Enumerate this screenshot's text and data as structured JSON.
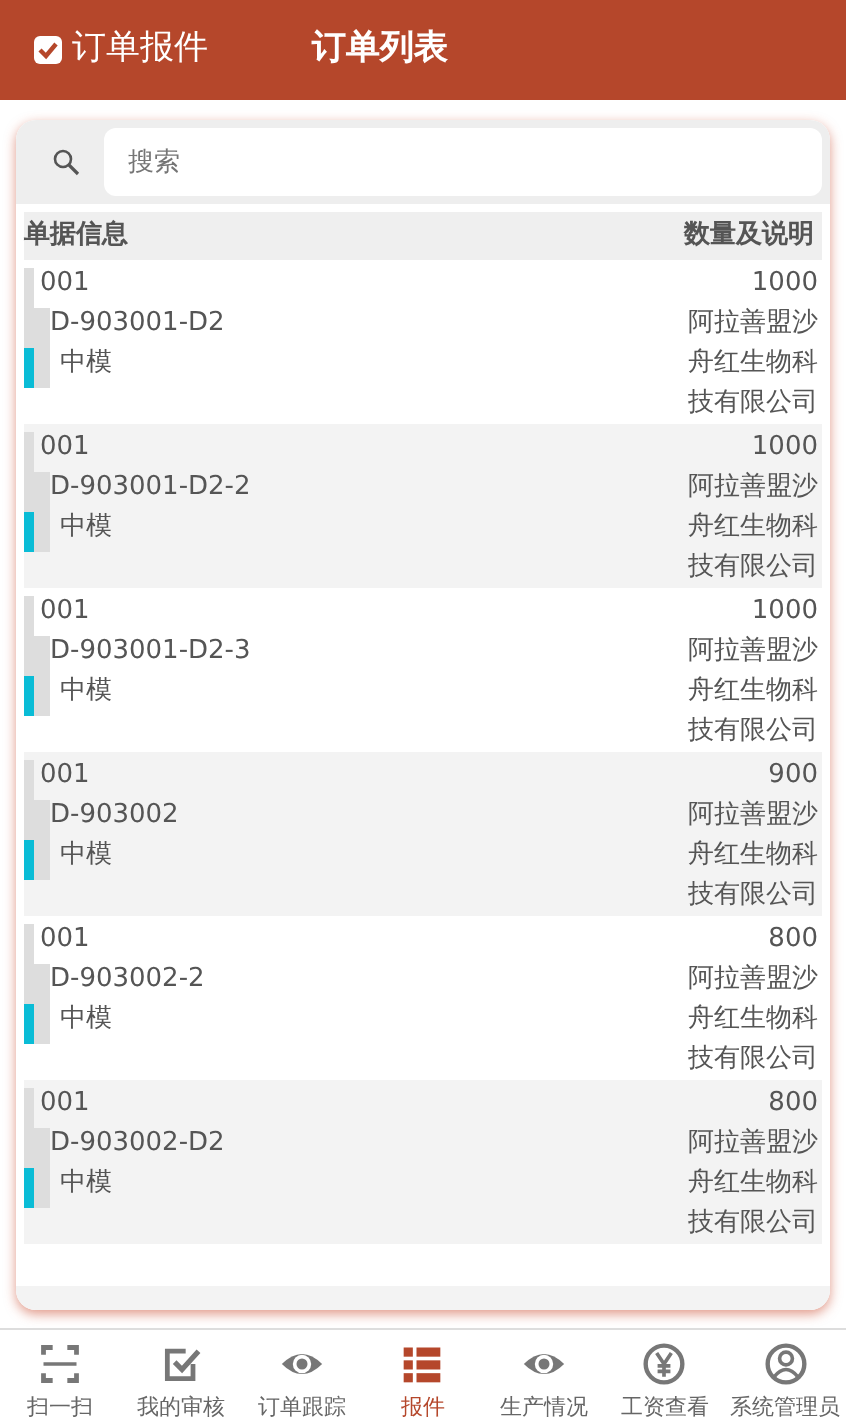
{
  "header": {
    "back_label": "订单报件",
    "title": "订单列表"
  },
  "search": {
    "placeholder": "搜索"
  },
  "table": {
    "columns": [
      "单据信息",
      "数量及说明"
    ],
    "rows": [
      {
        "code": "001",
        "order": "D-903001-D2",
        "mold": "中模",
        "quantity": "1000",
        "company_lines": [
          "阿拉善盟沙",
          "舟红生物科",
          "技有限公司"
        ]
      },
      {
        "code": "001",
        "order": "D-903001-D2-2",
        "mold": "中模",
        "quantity": "1000",
        "company_lines": [
          "阿拉善盟沙",
          "舟红生物科",
          "技有限公司"
        ]
      },
      {
        "code": "001",
        "order": "D-903001-D2-3",
        "mold": "中模",
        "quantity": "1000",
        "company_lines": [
          "阿拉善盟沙",
          "舟红生物科",
          "技有限公司"
        ]
      },
      {
        "code": "001",
        "order": "D-903002",
        "mold": "中模",
        "quantity": "900",
        "company_lines": [
          "阿拉善盟沙",
          "舟红生物科",
          "技有限公司"
        ]
      },
      {
        "code": "001",
        "order": "D-903002-2",
        "mold": "中模",
        "quantity": "800",
        "company_lines": [
          "阿拉善盟沙",
          "舟红生物科",
          "技有限公司"
        ]
      },
      {
        "code": "001",
        "order": "D-903002-D2",
        "mold": "中模",
        "quantity": "800",
        "company_lines": [
          "阿拉善盟沙",
          "舟红生物科",
          "技有限公司"
        ]
      }
    ]
  },
  "bottom_nav": [
    {
      "kind": "scan",
      "label": "扫一扫",
      "selected": false
    },
    {
      "kind": "check",
      "label": "我的审核",
      "selected": false
    },
    {
      "kind": "eye",
      "label": "订单跟踪",
      "selected": false
    },
    {
      "kind": "list",
      "label": "报件",
      "selected": true
    },
    {
      "kind": "eye",
      "label": "生产情况",
      "selected": false
    },
    {
      "kind": "yen",
      "label": "工资查看",
      "selected": false
    },
    {
      "kind": "user",
      "label": "系统管理员",
      "selected": false
    }
  ]
}
